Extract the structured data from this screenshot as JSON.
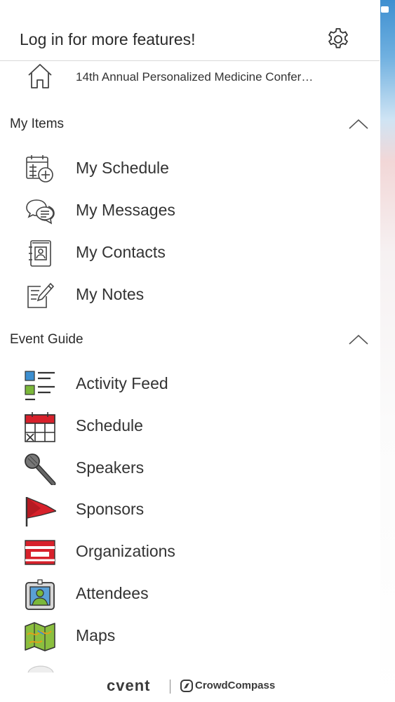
{
  "header": {
    "title": "Log in for more features!",
    "settings_icon": "gear-icon"
  },
  "event": {
    "name": "14th Annual Personalized Medicine Confer…",
    "icon": "home-icon"
  },
  "my_items": {
    "title": "My Items",
    "items": [
      {
        "label": "My Schedule",
        "icon": "calendar-add-icon"
      },
      {
        "label": "My Messages",
        "icon": "chat-bubbles-icon"
      },
      {
        "label": "My Contacts",
        "icon": "contact-book-icon"
      },
      {
        "label": "My Notes",
        "icon": "note-pencil-icon"
      }
    ]
  },
  "event_guide": {
    "title": "Event Guide",
    "items": [
      {
        "label": "Activity Feed",
        "icon": "activity-list-icon"
      },
      {
        "label": "Schedule",
        "icon": "calendar-icon"
      },
      {
        "label": "Speakers",
        "icon": "microphone-icon"
      },
      {
        "label": "Sponsors",
        "icon": "flag-icon"
      },
      {
        "label": "Organizations",
        "icon": "banner-icon"
      },
      {
        "label": "Attendees",
        "icon": "badge-icon"
      },
      {
        "label": "Maps",
        "icon": "map-icon"
      }
    ]
  },
  "footer": {
    "brand": "cvent",
    "partner": "CrowdCompass"
  },
  "colors": {
    "accent_red": "#d7212b",
    "line_gray": "#555555",
    "blue": "#3d8fd0",
    "green": "#7bb83a"
  }
}
